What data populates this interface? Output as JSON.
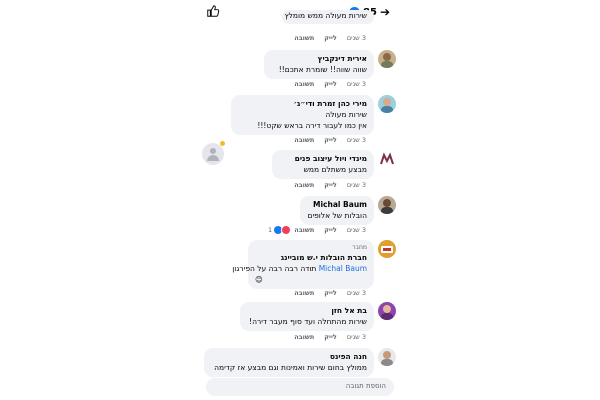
{
  "header": {
    "like_count": "85",
    "back_glyph": "➔"
  },
  "colors": {
    "accent": "#1877f2",
    "bubble": "#f0f2f5",
    "meta": "#65676b",
    "link": "#216fdb"
  },
  "actions": {
    "time": "3 שנים",
    "like": "לייק",
    "reply": "תשובה"
  },
  "comments": [
    {
      "author": "",
      "lines": [
        "שירות מעולה ממש מומלץ"
      ]
    },
    {
      "author": "אירית דינקביץ",
      "lines": [
        "שווה שווה!! שומרת אתכם!!"
      ]
    },
    {
      "author": "מירי כהן זמרת ודי״ג׳",
      "lines": [
        "שירות מעולה",
        "אין כמו לעבור דירה בראש שקט!!!"
      ]
    },
    {
      "author": "מינדי ויול עיצוב פנים",
      "lines": [
        "מבצע משתלם ממש"
      ]
    },
    {
      "author": "Michal Baum",
      "lines": [
        "הובלות של אלופים"
      ]
    },
    {
      "author_tag": "מחבר",
      "author": "חברת הובלות י.ש מוביינג",
      "mention": "Michal Baum",
      "lines": [
        "תודה רבה רבה על הפירגון",
        "😊"
      ],
      "reaction_count": "1"
    },
    {
      "author": "בת אל חזן",
      "lines": [
        "שירות מהתחלה ועד סוף מעבר דירה!"
      ]
    },
    {
      "author": "חנה הפינס",
      "lines": [
        "ממולץ בחום שירות ואמינות וגם מבצע אז קדימה"
      ]
    }
  ],
  "reply_box": {
    "placeholder": "הוספת תגובה"
  }
}
